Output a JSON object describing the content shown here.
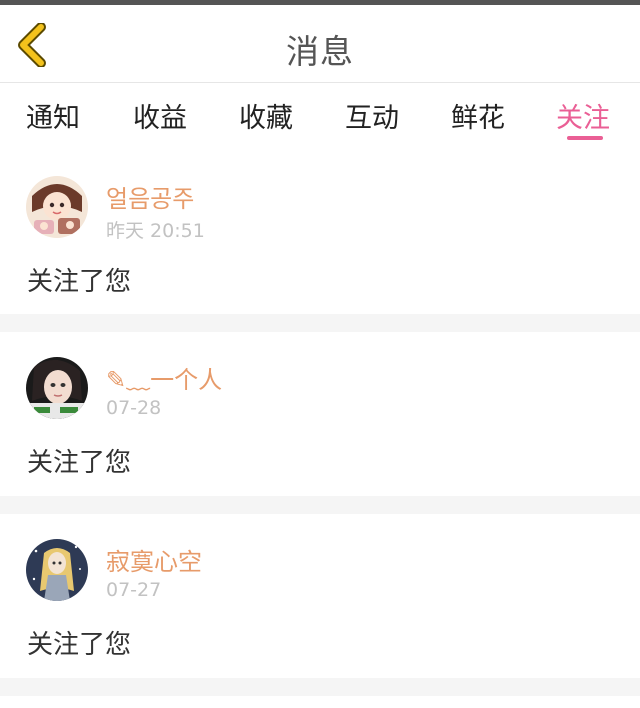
{
  "header": {
    "title": "消息",
    "back_icon": "chevron-left-icon",
    "back_color": "#f3c21c"
  },
  "tabs": [
    {
      "label": "通知",
      "active": false
    },
    {
      "label": "收益",
      "active": false
    },
    {
      "label": "收藏",
      "active": false
    },
    {
      "label": "互动",
      "active": false
    },
    {
      "label": "鲜花",
      "active": false
    },
    {
      "label": "关注",
      "active": true
    }
  ],
  "colors": {
    "accent": "#ea5f95",
    "username": "#e79b6a",
    "timestamp": "#c2c2c2"
  },
  "notifications": [
    {
      "username": "얼음공주",
      "time": "昨天 20:51",
      "message": "关注了您"
    },
    {
      "username": "✎﹏一个人",
      "time": "07-28",
      "message": "关注了您"
    },
    {
      "username": "寂寞心空",
      "time": "07-27",
      "message": "关注了您"
    }
  ]
}
